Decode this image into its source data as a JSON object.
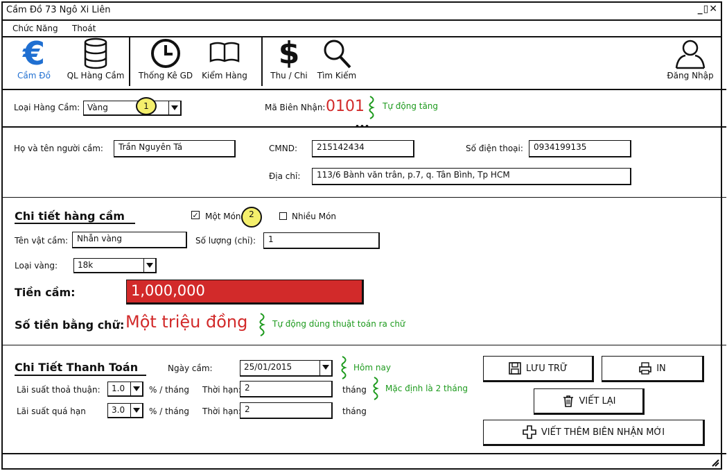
{
  "window": {
    "title": "Cầm Đồ 73 Ngô Xi Liên",
    "controls": "_▯✕"
  },
  "menu": {
    "items": [
      "Chức Năng",
      "Thoát"
    ]
  },
  "toolbar": {
    "buttons": [
      {
        "label": "Cầm Đồ",
        "icon": "euro-icon"
      },
      {
        "label": "QL Hàng Cầm",
        "icon": "database-icon"
      },
      {
        "label": "Thống Kê GD",
        "icon": "clock-icon"
      },
      {
        "label": "Kiểm Hàng",
        "icon": "book-icon"
      },
      {
        "label": "Thu / Chi",
        "icon": "dollar-icon"
      },
      {
        "label": "Tìm Kiếm",
        "icon": "search-icon"
      },
      {
        "label": "Đăng Nhập",
        "icon": "user-icon"
      }
    ],
    "euro_glyph": "€",
    "dollar_glyph": "$"
  },
  "top": {
    "item_type_label": "Loại Hàng Cầm:",
    "item_type_value": "Vàng",
    "receipt_label": "Mã Biên Nhận:",
    "receipt_value": "0101",
    "receipt_note": "Tự động tăng",
    "marker1": "1",
    "ellipsis": "•••"
  },
  "customer": {
    "name_label": "Họ và tên người cầm:",
    "name_value": "Trần Nguyên Tá",
    "id_label": "CMND:",
    "id_value": "215142434",
    "phone_label": "Số điện thoại:",
    "phone_value": "0934199135",
    "address_label": "Địa chỉ:",
    "address_value": "113/6 Bành văn trân, p.7, q. Tân Bình, Tp HCM"
  },
  "detail": {
    "title": "Chi tiết hàng cầm",
    "single_label": "Một Món",
    "single_checked": true,
    "multi_label": "Nhiều Món",
    "multi_checked": false,
    "marker2": "2",
    "item_name_label": "Tên vật cầm:",
    "item_name_value": "Nhẫn vàng",
    "qty_label": "Số lượng (chỉ):",
    "qty_value": "1",
    "gold_type_label": "Loại vàng:",
    "gold_type_value": "18k",
    "amount_label": "Tiền cầm:",
    "amount_value": "1,000,000",
    "words_label": "Số tiền bằng chữ:",
    "words_value": "Một triệu đồng",
    "words_note": "Tự động dùng thuật toán ra chữ"
  },
  "payment": {
    "title": "Chi Tiết Thanh Toán",
    "date_label": "Ngày cầm:",
    "date_value": "25/01/2015",
    "date_note": "Hôm nay",
    "rate_label": "Lãi suất thoả thuận:",
    "rate_value": "1.0",
    "per_month": "% / tháng",
    "term_label": "Thời hạn:",
    "term_value": "2",
    "term_unit": "tháng",
    "term_note": "Mặc định là 2 tháng",
    "overdue_label": "Lãi suất quá hạn",
    "overdue_value": "3.0",
    "term2_value": "2"
  },
  "actions": {
    "save": "LƯU TRỮ",
    "print": "IN",
    "reset": "VIẾT LẠI",
    "new_receipt": "VIẾT THÊM BIÊN NHẬN MỚI"
  },
  "colors": {
    "accent": "#1f6fd1",
    "red": "#d22a2a",
    "green": "#1d9a1d",
    "highlight": "#f4ef6c"
  }
}
